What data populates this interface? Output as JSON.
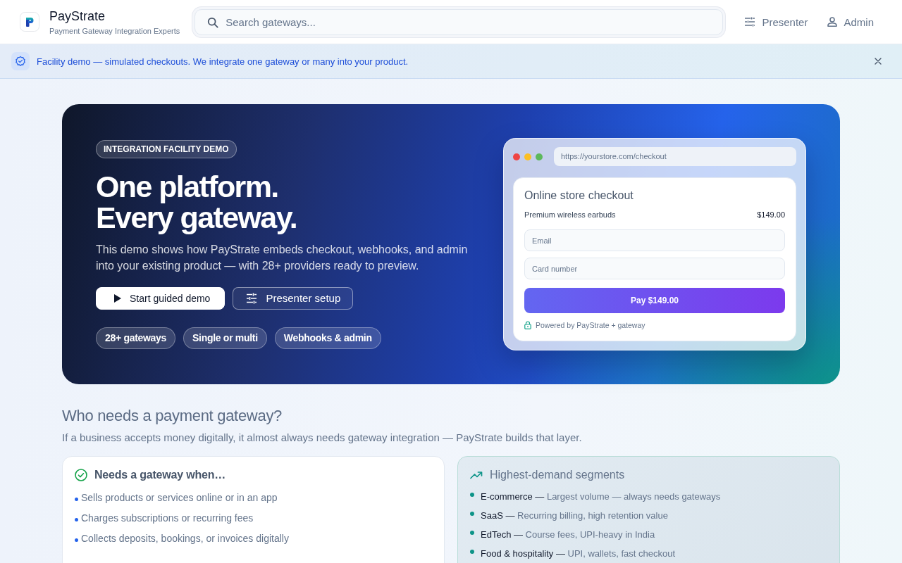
{
  "header": {
    "brand": {
      "name": "PayStrate",
      "tagline": "Payment Gateway Integration Experts"
    },
    "search": {
      "placeholder": "Search gateways..."
    },
    "nav": [
      {
        "label": "Presenter"
      },
      {
        "label": "Admin"
      }
    ]
  },
  "banner": {
    "text": "Facility demo — simulated checkouts. We integrate one gateway or many into your product."
  },
  "hero": {
    "badge": "INTEGRATION FACILITY DEMO",
    "title_lines": [
      "One platform.",
      "Every gateway."
    ],
    "description": "This demo shows how PayStrate embeds checkout, webhooks, and admin into your existing product — with 28+ providers ready to preview.",
    "buttons": [
      {
        "label": "Start guided demo",
        "kind": "primary"
      },
      {
        "label": "Presenter setup",
        "kind": "outline"
      }
    ],
    "chips": [
      "28+ gateways",
      "Single or multi",
      "Webhooks & admin"
    ],
    "checkout_preview": {
      "url": "https://yourstore.com/checkout",
      "title": "Online store checkout",
      "item": {
        "name": "Premium wireless earbuds",
        "price": "$149.00"
      },
      "fields": [
        {
          "placeholder": "Email"
        },
        {
          "placeholder": "Card number"
        }
      ],
      "pay_button": "Pay $149.00",
      "footer": "Powered by PayStrate + gateway"
    }
  },
  "who_needs": {
    "title": "Who needs a payment gateway?",
    "subtitle": "If a business accepts money digitally, it almost always needs gateway integration — PayStrate builds that layer.",
    "cards": [
      {
        "kind": "checklist",
        "title": "Needs a gateway when…",
        "items": [
          "Sells products or services online or in an app",
          "Charges subscriptions or recurring fees",
          "Collects deposits, bookings, or invoices digitally"
        ]
      },
      {
        "kind": "segments",
        "title": "Highest-demand segments",
        "items": [
          "**E-commerce —** Largest volume — always needs gateways",
          "**SaaS —** Recurring billing, high retention value",
          "**EdTech —** Course fees, UPI-heavy in India",
          "**Food & hospitality —** UPI, wallets, fast checkout"
        ]
      }
    ]
  }
}
